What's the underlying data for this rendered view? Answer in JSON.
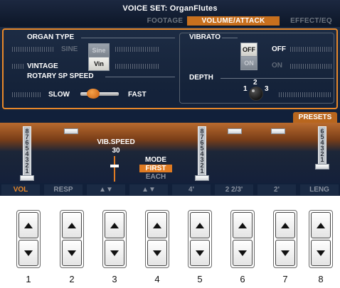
{
  "header": {
    "title": "VOICE SET: OrganFlutes",
    "tabs": [
      "FOOTAGE",
      "VOLUME/ATTACK",
      "EFFECT/EQ"
    ],
    "active_tab": "VOLUME/ATTACK"
  },
  "organ_type": {
    "label": "ORGAN TYPE",
    "options": [
      "SINE",
      "VINTAGE"
    ],
    "button_top": "Sine",
    "button_bottom": "Vin",
    "selected": "VINTAGE"
  },
  "rotary": {
    "label": "ROTARY SP SPEED",
    "left": "SLOW",
    "right": "FAST",
    "value": "FAST"
  },
  "vibrato": {
    "label": "VIBRATO",
    "button_top": "OFF",
    "button_bottom": "ON",
    "state_top": "OFF",
    "state_bottom": "ON",
    "selected": "OFF",
    "depth_label": "DEPTH",
    "depth_marks": [
      "1",
      "2",
      "3"
    ]
  },
  "presets_label": "PRESETS",
  "drawbars": {
    "vol_numbers": [
      "8",
      "7",
      "6",
      "5",
      "4",
      "3",
      "2",
      "1"
    ],
    "four_numbers": [
      "8",
      "7",
      "6",
      "5",
      "4",
      "3",
      "2",
      "1"
    ],
    "leng_numbers": [
      "6",
      "5",
      "4",
      "3",
      "2",
      "1"
    ],
    "vib_speed_label": "VIB.SPEED",
    "vib_speed_value": "30",
    "mode_label": "MODE",
    "mode_options": [
      "FIRST",
      "EACH"
    ],
    "mode_selected": "FIRST"
  },
  "bottom_labels": [
    "VOL",
    "RESP",
    "▲▼",
    "▲▼",
    "4'",
    "2 2/3'",
    "2'",
    "LENG"
  ],
  "buttons": {
    "numbers": [
      "1",
      "2",
      "3",
      "4",
      "5",
      "6",
      "7",
      "8"
    ]
  },
  "colors": {
    "accent": "#e8882a",
    "screen_bg": "#11203a"
  },
  "icons": [
    "triangle-up-icon",
    "triangle-down-icon",
    "knob-icon"
  ]
}
